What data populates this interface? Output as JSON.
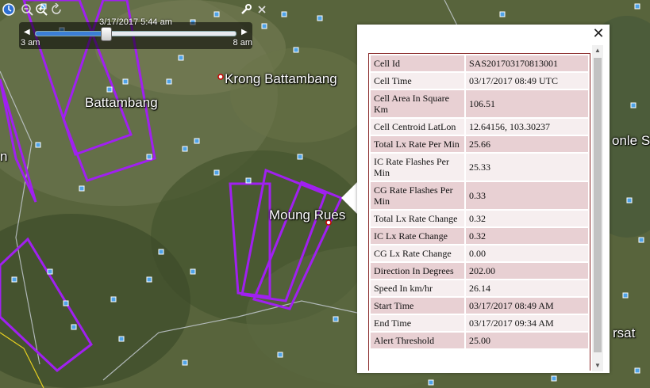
{
  "map": {
    "labels": {
      "krong_battambang": "Krong Battambang",
      "battambang": "Battambang",
      "moung_ruessei": "Moung Rues",
      "tonle_sap": "onle S",
      "pursat": "rsat",
      "left_partial": "n"
    },
    "polygon_color": "#a020f0"
  },
  "toolbar": {
    "icons": [
      "clock-icon",
      "zoom-out-icon",
      "zoom-in-icon",
      "refresh-icon",
      "wrench-icon",
      "close-icon"
    ]
  },
  "timebar": {
    "current": "3/17/2017   5:44 am",
    "start": "3 am",
    "end": "8 am",
    "position": 0.35
  },
  "popup": {
    "close_label": "✕",
    "rows": [
      {
        "key": "Cell Id",
        "value": "SAS201703170813001"
      },
      {
        "key": "Cell Time",
        "value": "03/17/2017 08:49 UTC"
      },
      {
        "key": "Cell Area In Square Km",
        "value": "106.51"
      },
      {
        "key": "Cell Centroid LatLon",
        "value": "12.64156, 103.30237"
      },
      {
        "key": "Total Lx Rate Per Min",
        "value": "25.66"
      },
      {
        "key": "IC Rate Flashes Per Min",
        "value": "25.33"
      },
      {
        "key": "CG Rate Flashes Per Min",
        "value": "0.33"
      },
      {
        "key": "Total Lx Rate Change",
        "value": "0.32"
      },
      {
        "key": "IC Lx Rate Change",
        "value": "0.32"
      },
      {
        "key": "CG Lx Rate Change",
        "value": "0.00"
      },
      {
        "key": "Direction In Degrees",
        "value": "202.00"
      },
      {
        "key": "Speed In km/hr",
        "value": "26.14"
      },
      {
        "key": "Start Time",
        "value": "03/17/2017 08:49 AM"
      },
      {
        "key": "End Time",
        "value": "03/17/2017 09:34 AM"
      },
      {
        "key": "Alert Threshold",
        "value": "25.00"
      }
    ]
  }
}
